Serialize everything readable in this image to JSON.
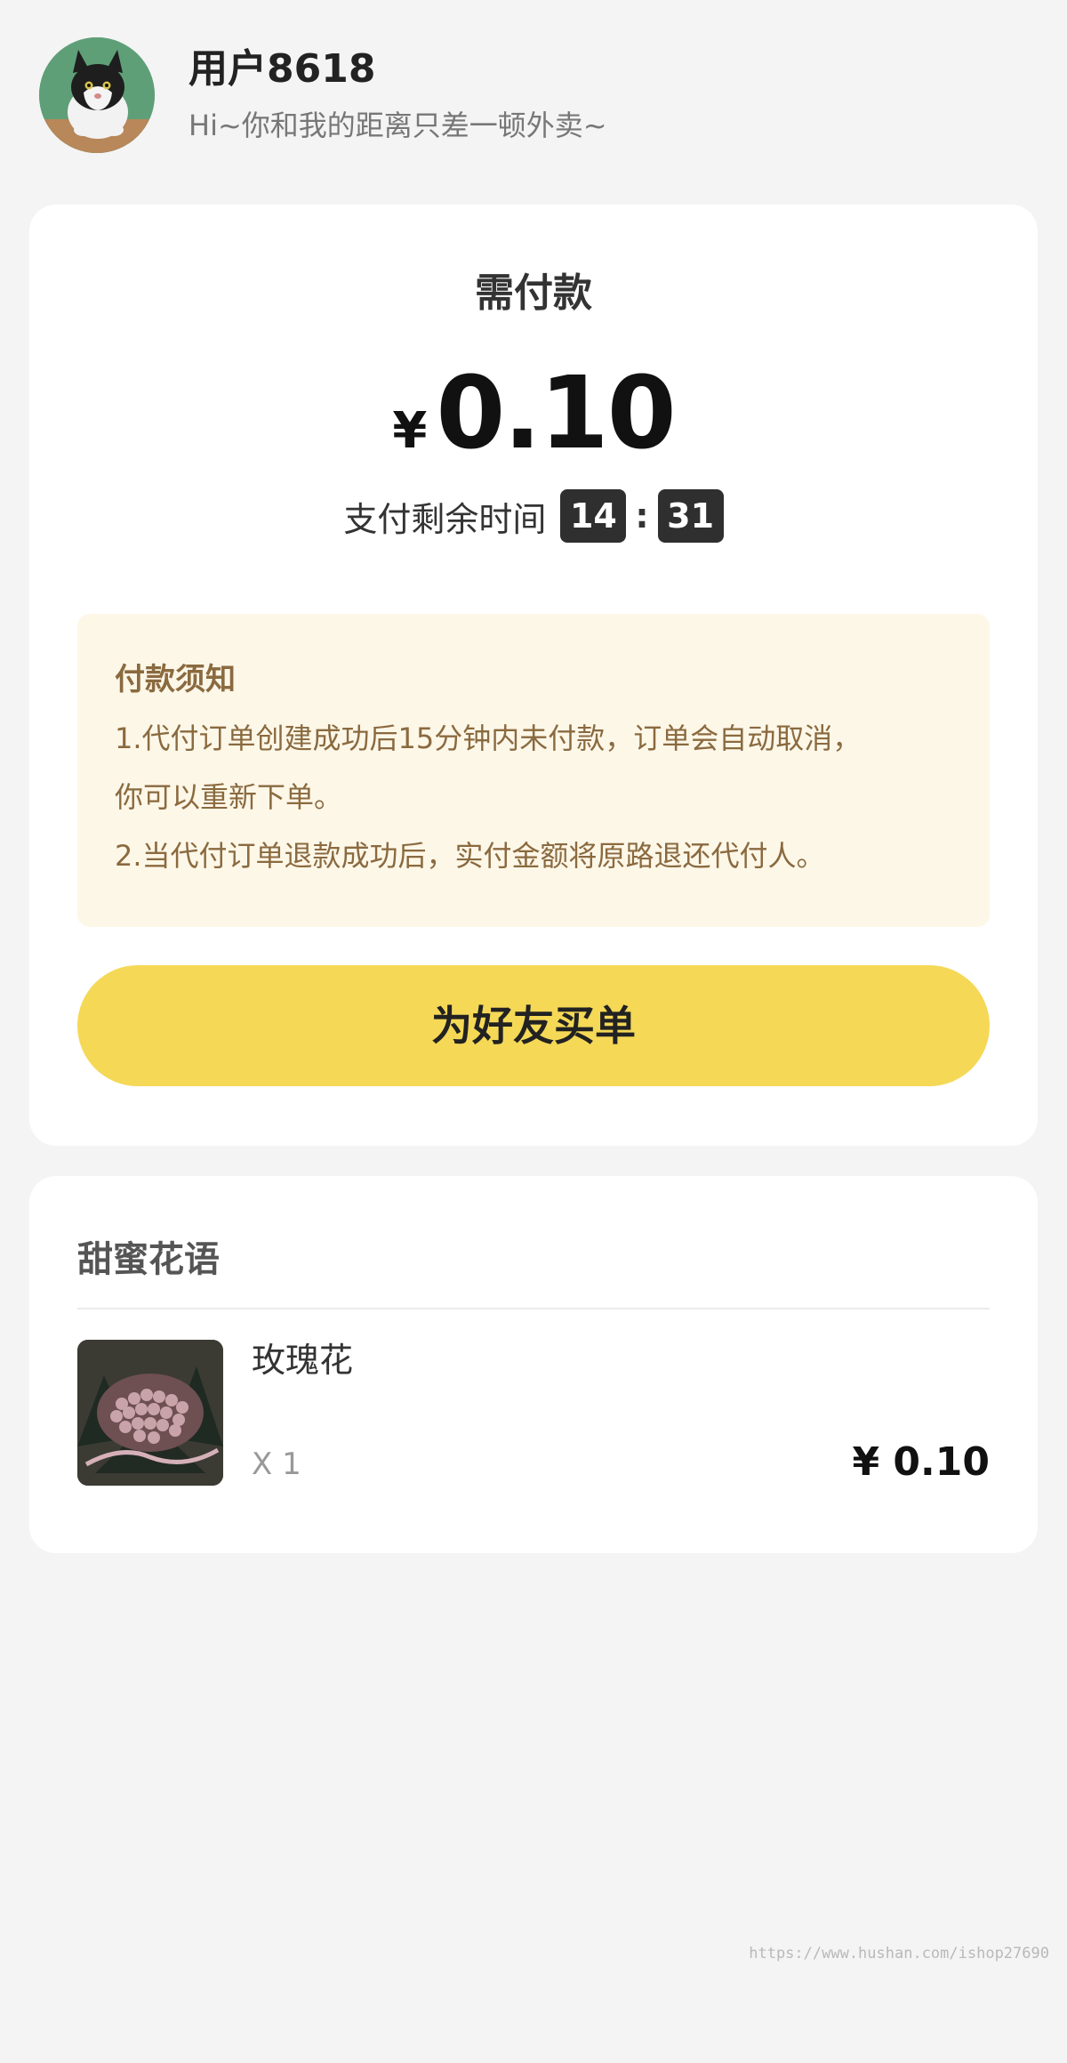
{
  "header": {
    "user_name": "用户8618",
    "greeting": "Hi~你和我的距离只差一顿外卖~",
    "avatar_icon": "cat-avatar"
  },
  "payment": {
    "title": "需付款",
    "currency": "¥",
    "amount": "0.10",
    "timer_label": "支付剩余时间",
    "timer_minutes": "14",
    "timer_separator": ":",
    "timer_seconds": "31"
  },
  "notice": {
    "title": "付款须知",
    "lines": [
      "1.代付订单创建成功后15分钟内未付款，订单会自动取消，",
      "你可以重新下单。",
      "2.当代付订单退款成功后，实付金额将原路退还代付人。"
    ]
  },
  "buy_button": {
    "label": "为好友买单"
  },
  "order": {
    "shop_name": "甜蜜花语",
    "items": [
      {
        "name": "玫瑰花",
        "quantity": "X 1",
        "price": "¥ 0.10",
        "image_icon": "rose-bouquet-image"
      }
    ]
  },
  "watermark": "https://www.hushan.com/ishop27690",
  "colors": {
    "background": "#f4f4f4",
    "card": "#ffffff",
    "notice_bg": "#fdf7e8",
    "notice_text": "#8a6a3f",
    "button": "#f5d856",
    "timer_box": "#2f2f2f"
  }
}
